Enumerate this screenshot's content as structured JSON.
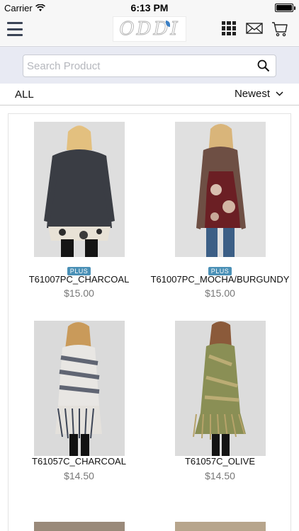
{
  "status_bar": {
    "carrier": "Carrier",
    "time": "6:13 PM"
  },
  "header": {
    "logo_text": "ODDI",
    "icons": [
      "menu-icon",
      "grid-icon",
      "mail-icon",
      "cart-icon"
    ]
  },
  "search": {
    "placeholder": "Search Product",
    "value": ""
  },
  "filter": {
    "category": "ALL",
    "sort_label": "Newest"
  },
  "products": [
    {
      "badge": "PLUS",
      "name": "T61007PC_CHARCOAL",
      "price": "$15.00"
    },
    {
      "badge": "PLUS",
      "name": "T61007PC_MOCHA/BURGUNDY",
      "price": "$15.00"
    },
    {
      "badge": "",
      "name": "T61057C_CHARCOAL",
      "price": "$14.50"
    },
    {
      "badge": "",
      "name": "T61057C_OLIVE",
      "price": "$14.50"
    }
  ],
  "colors": {
    "badge": "#4a90b6",
    "price": "#777777",
    "search_bg": "#e8eaf3"
  }
}
